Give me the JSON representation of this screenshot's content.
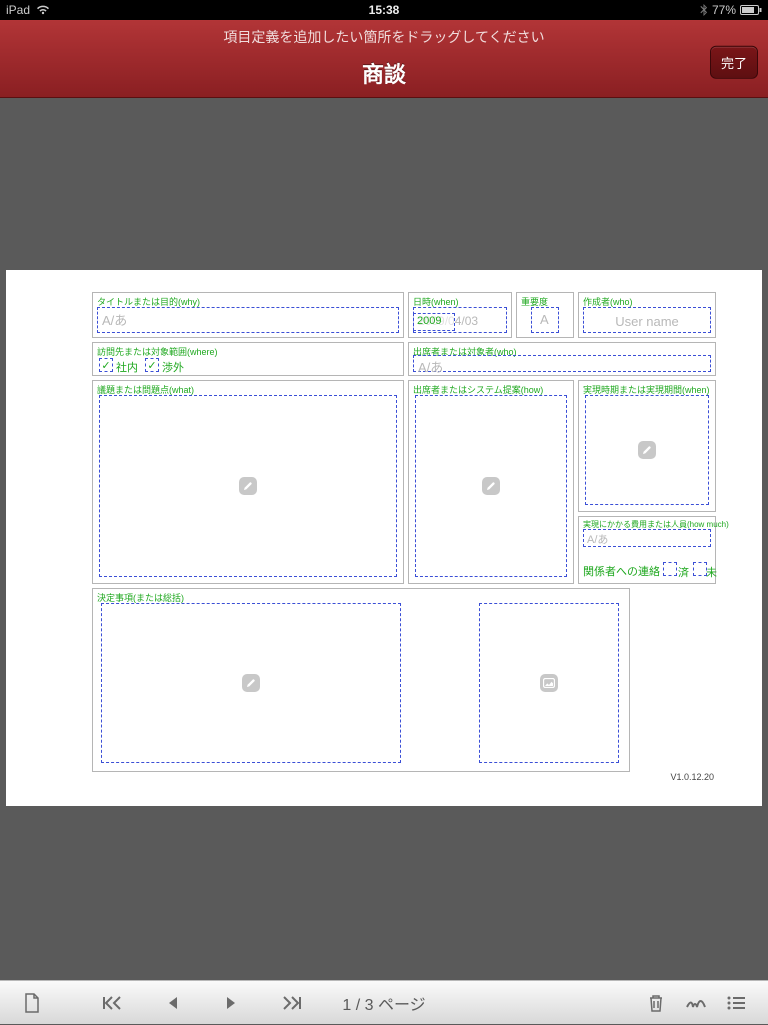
{
  "status": {
    "device": "iPad",
    "time": "15:38",
    "battery": "77%"
  },
  "header": {
    "instruction": "項目定義を追加したい箇所をドラッグしてください",
    "title": "商談",
    "done": "完了"
  },
  "form": {
    "f_title": {
      "label": "タイトルまたは目的(why)",
      "placeholder": "A/あ"
    },
    "f_date": {
      "label": "日時(when)",
      "value_display": "2009/04/03",
      "value_overlay": "2009"
    },
    "f_priority": {
      "label": "重要度",
      "placeholder": "A"
    },
    "f_author": {
      "label": "作成者(who)",
      "placeholder": "User name"
    },
    "f_where": {
      "label": "訪問先または対象範囲(where)",
      "opt1": "社内",
      "opt2": "渉外"
    },
    "f_who": {
      "label": "出席者または対象者(who)",
      "placeholder": "A/あ"
    },
    "f_what": {
      "label": "議題または問題点(what)"
    },
    "f_how": {
      "label": "出席者またはシステム提案(how)"
    },
    "f_when2": {
      "label": "実現時期または実現期間(when)"
    },
    "f_howmuch": {
      "label": "実現にかかる費用または人員(how much)",
      "placeholder": "A/あ"
    },
    "f_contact": {
      "label": "関係者への連絡",
      "opt1": "済",
      "opt2": "未"
    },
    "f_decision": {
      "label": "決定事項(または総括)"
    },
    "version": "V1.0.12.20"
  },
  "footer": {
    "pager": "1 / 3 ページ"
  }
}
